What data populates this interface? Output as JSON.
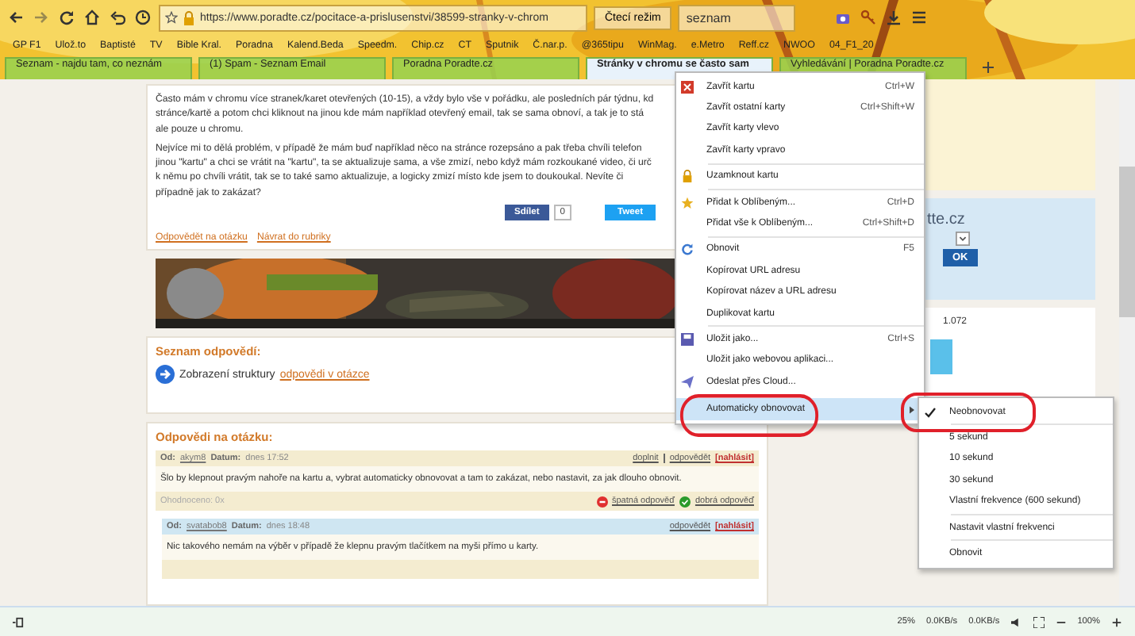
{
  "toolbar": {
    "url": "https://www.poradte.cz/pocitace-a-prislusenstvi/38599-stranky-v-chrom",
    "reader_mode": "Čtecí režim",
    "search": "seznam"
  },
  "bookmarks": [
    "GP F1",
    "Ulož.to",
    "Baptisté",
    "TV",
    "Bible Kral.",
    "Poradna",
    "Kalend.Beda",
    "Speedm.",
    "Chip.cz",
    "CT",
    "Sputnik",
    "Č.nar.p.",
    "@365tipu",
    "WinMag.",
    "e.Metro",
    "Reff.cz",
    "NWOO",
    "04_F1_20"
  ],
  "tabs": [
    {
      "label": "Seznam - najdu tam, co neznám",
      "selected": false
    },
    {
      "label": "(1) Spam - Seznam Email",
      "selected": false
    },
    {
      "label": "Poradna Poradte.cz",
      "selected": false
    },
    {
      "label": "Stránky v chromu se často sam",
      "selected": true
    },
    {
      "label": "Vyhledávání | Poradna Poradte.cz",
      "selected": false
    }
  ],
  "question": {
    "paragraphs": [
      [
        "Často mám v chromu více stranek/karet otevřených (10-15), a vždy bylo vše v pořádku, ale posledních pár týdnu, kd",
        "stránce/kartě a potom chci kliknout na jinou kde mám například otevřený email, tak se sama obnoví, a tak je to stá",
        "ale pouze u chromu."
      ],
      [
        "Nejvíce mi to dělá problém, v případě že mám buď například něco na stránce rozepsáno a pak třeba chvíli telefon",
        "jinou \"kartu\" a chci se vrátit na \"kartu\", ta se aktualizuje sama, a vše zmizí, nebo když mám rozkoukané video, či urč",
        "k němu po chvíli vrátit, tak se to také samo aktualizuje, a logicky zmizí místo kde jsem to doukoukal. Nevíte či",
        "případně jak to zakázat?"
      ]
    ],
    "share": "Sdílet",
    "share_count": "0",
    "tweet": "Tweet",
    "links": [
      "Odpovědět na otázku",
      "Návrat do rubriky"
    ]
  },
  "answers_list": {
    "title": "Seznam odpovědí:",
    "text": "Zobrazení struktury",
    "link": "odpovědi v otázce"
  },
  "answers": {
    "title": "Odpovědi na otázku:",
    "items": [
      {
        "from_label": "Od:",
        "author": "akym8",
        "date_label": "Datum:",
        "date": "dnes 17:52",
        "actions": [
          "doplnit",
          "odpovědět"
        ],
        "report": "[nahlásit]",
        "text": "Šlo by klepnout pravým nahoře na kartu a, vybrat automaticky obnovovat a tam to zakázat, nebo nastavit, za jak dlouho obnovit.",
        "rating": "Ohodnoceno: 0x",
        "bad": "špatná odpověď",
        "good": "dobrá odpověď"
      },
      {
        "from_label": "Od:",
        "author": "svatabob8",
        "date_label": "Datum:",
        "date": "dnes 18:48",
        "actions": [
          "odpovědět"
        ],
        "report": "[nahlásit]",
        "text": "Nic takového nemám na výběr v případě že klepnu pravým tlačítkem na myši přímo u karty."
      }
    ]
  },
  "sidebar": {
    "title": "tte.cz",
    "button": "OK",
    "like_count": "1.072"
  },
  "menu": [
    {
      "kind": "item",
      "label": "Zavřít kartu",
      "shortcut": "Ctrl+W"
    },
    {
      "kind": "item",
      "label": "Zavřít ostatní karty",
      "shortcut": "Ctrl+Shift+W"
    },
    {
      "kind": "item",
      "label": "Zavřít karty vlevo"
    },
    {
      "kind": "item",
      "label": "Zavřít karty vpravo"
    },
    {
      "kind": "separator"
    },
    {
      "kind": "item",
      "label": "Uzamknout kartu"
    },
    {
      "kind": "separator"
    },
    {
      "kind": "item",
      "label": "Přidat k Oblíbeným...",
      "shortcut": "Ctrl+D"
    },
    {
      "kind": "item",
      "label": "Přidat vše k Oblíbeným...",
      "shortcut": "Ctrl+Shift+D"
    },
    {
      "kind": "separator"
    },
    {
      "kind": "item",
      "label": "Obnovit",
      "shortcut": "F5"
    },
    {
      "kind": "item",
      "label": "Kopírovat URL adresu"
    },
    {
      "kind": "item",
      "label": "Kopírovat název a URL adresu"
    },
    {
      "kind": "item",
      "label": "Duplikovat kartu"
    },
    {
      "kind": "separator"
    },
    {
      "kind": "item",
      "label": "Uložit jako...",
      "shortcut": "Ctrl+S"
    },
    {
      "kind": "item",
      "label": "Uložit jako webovou aplikaci..."
    },
    {
      "kind": "item",
      "label": "Odeslat přes Cloud..."
    },
    {
      "kind": "submenu",
      "label": "Automaticky obnovovat",
      "selected": true
    }
  ],
  "submenu": [
    {
      "kind": "item",
      "label": "Neobnovovat",
      "checked": true
    },
    {
      "kind": "separator"
    },
    {
      "kind": "item",
      "label": "5 sekund",
      "checked": false
    },
    {
      "kind": "item",
      "label": "10 sekund",
      "checked": false
    },
    {
      "kind": "item",
      "label": "30 sekund",
      "checked": false
    },
    {
      "kind": "item",
      "label": "Vlastní frekvence (600 sekund)",
      "checked": false
    },
    {
      "kind": "separator"
    },
    {
      "kind": "item",
      "label": "Nastavit vlastní frekvenci",
      "checked": false
    },
    {
      "kind": "separator"
    },
    {
      "kind": "item",
      "label": "Obnovit",
      "checked": false
    }
  ],
  "status_bar": {
    "cpu": "25%",
    "down": "0.0KB/s",
    "up": "0.0KB/s",
    "zoom": "100%"
  }
}
